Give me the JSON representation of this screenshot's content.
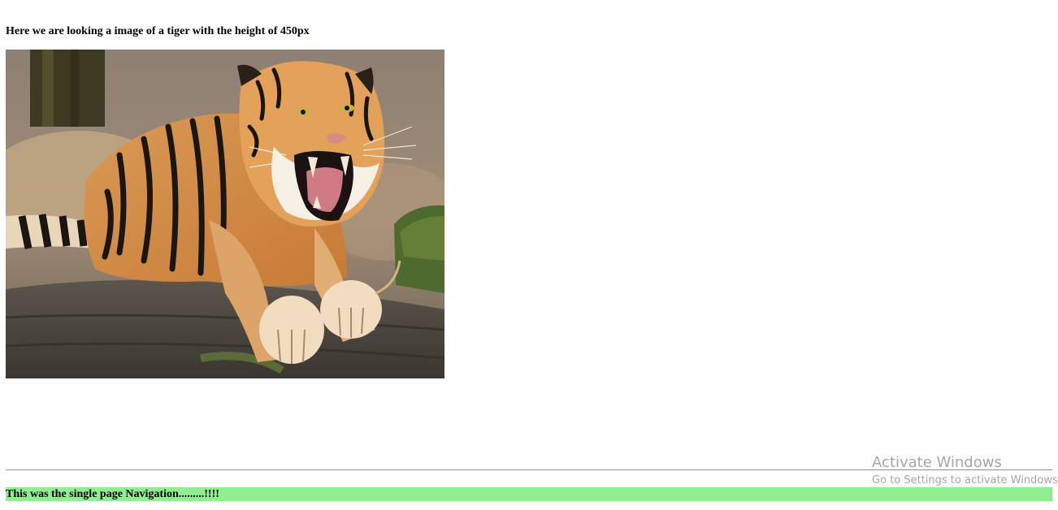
{
  "content": {
    "heading": "Here we are looking a image of a tiger with the height of 450px",
    "image_alt": "tiger",
    "footer_text": "This was the single page Navigation.........!!!!"
  },
  "overlay": {
    "activate_title": "Activate Windows",
    "activate_sub": "Go to Settings to activate Windows."
  },
  "colors": {
    "footer_bg": "#90ee90",
    "rule": "#9a9a9a",
    "watermark_text": "#969696"
  }
}
